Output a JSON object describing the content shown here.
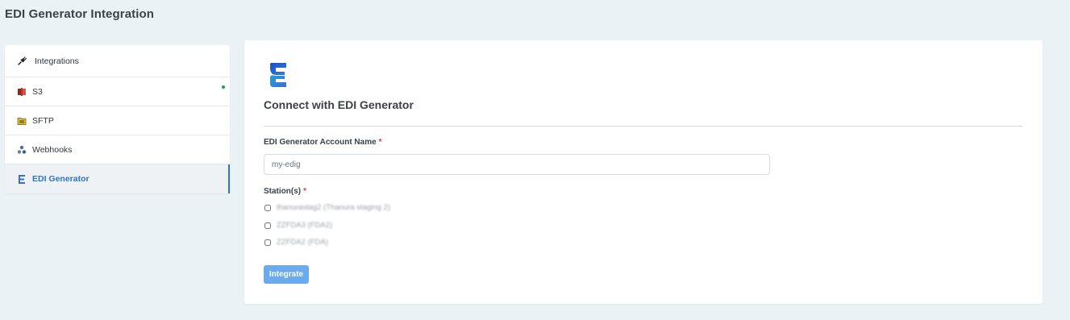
{
  "page": {
    "title": "EDI Generator Integration"
  },
  "sidebar": {
    "items": [
      {
        "label": "Integrations",
        "icon": "plug-icon"
      },
      {
        "label": "S3",
        "icon": "s3-bucket-icon",
        "status_color": "#1e9e4a"
      },
      {
        "label": "SFTP",
        "icon": "folder-icon"
      },
      {
        "label": "Webhooks",
        "icon": "webhook-icon"
      },
      {
        "label": "EDI Generator",
        "icon": "edi-generator-icon",
        "active": true
      }
    ]
  },
  "main": {
    "logo_icon": "edi-generator-logo",
    "title": "Connect with EDI Generator",
    "account_name": {
      "label": "EDI Generator Account Name",
      "required_mark": "*",
      "value": "my-edig"
    },
    "stations": {
      "label": "Station(s)",
      "required_mark": "*",
      "options": [
        {
          "label": "thanurastag2 (Thanura staging 2)",
          "checked": false
        },
        {
          "label": "ZZFDA3 (FDA2)",
          "checked": false
        },
        {
          "label": "ZZFDA2 (FDA)",
          "checked": false
        }
      ]
    },
    "integrate_button": {
      "label": "Integrate"
    }
  },
  "colors": {
    "background": "#ebf2f5",
    "accent": "#2e74c9",
    "button": "#6aabf0",
    "required": "#e03b3b",
    "status_online": "#1e9e4a"
  }
}
